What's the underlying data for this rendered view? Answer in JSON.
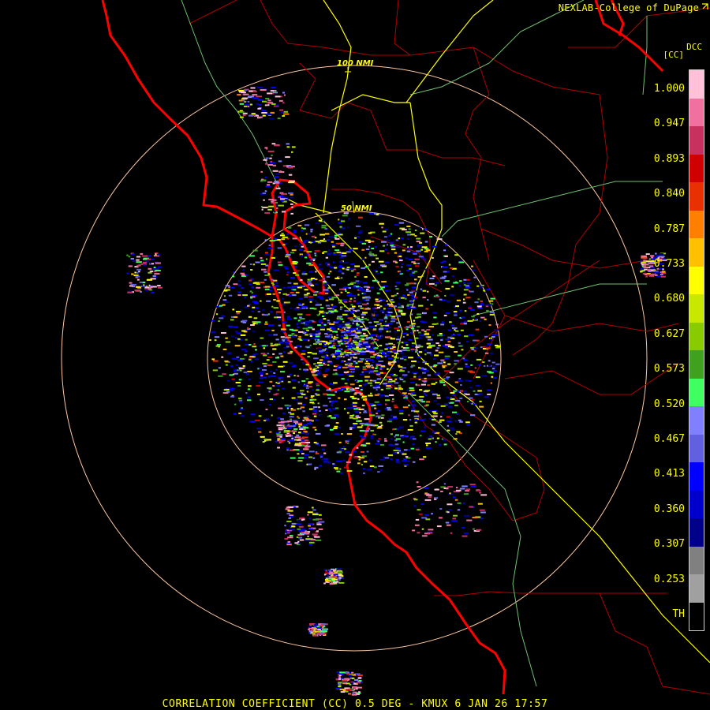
{
  "header": {
    "credit": "NEXLAB-College of DuPage",
    "credit_icon": "arrow-icon"
  },
  "legend": {
    "product_code": "DCC",
    "unit": "[CC]",
    "ticks": [
      "1.000",
      "0.947",
      "0.893",
      "0.840",
      "0.787",
      "0.733",
      "0.680",
      "0.627",
      "0.573",
      "0.520",
      "0.467",
      "0.413",
      "0.360",
      "0.307",
      "0.253",
      "TH"
    ],
    "colors": [
      "#ffc0d8",
      "#f070a0",
      "#c83060",
      "#d00000",
      "#e83000",
      "#ff8000",
      "#ffc000",
      "#ffff00",
      "#c8e800",
      "#88cc00",
      "#40a020",
      "#40ff60",
      "#8080ff",
      "#6060e0",
      "#0000ff",
      "#0000cc",
      "#000088",
      "#808080",
      "#a0a0a0",
      "#000000"
    ]
  },
  "range_rings": [
    {
      "label": "50 NMI"
    },
    {
      "label": "100 NMI"
    }
  ],
  "footer": {
    "text": "CORRELATION COEFFICIENT (CC) 0.5 DEG - KMUX 6 JAN 26 17:57"
  },
  "map_colors": {
    "coastline": "#ff0000",
    "county": "#b00000",
    "highway": "#ffff00",
    "road": "#70c070",
    "ring": "#ffc8a0"
  }
}
